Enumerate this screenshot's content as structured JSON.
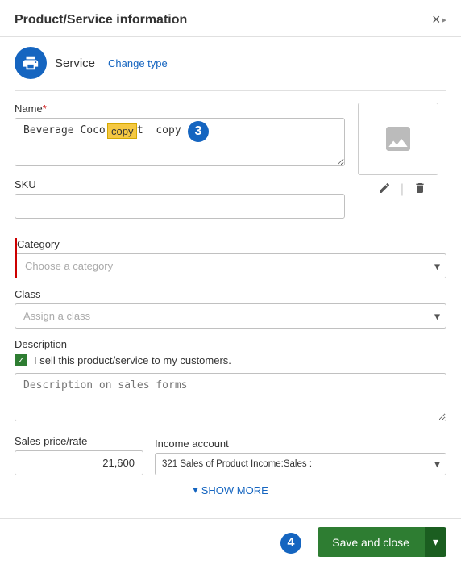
{
  "modal": {
    "title": "Product/Service information",
    "close_label": "×"
  },
  "service": {
    "type": "Service",
    "change_type": "Change type",
    "icon": "🖨"
  },
  "form": {
    "name_label": "Name",
    "name_required": "*",
    "name_value": "Beverage Coco Coast ",
    "name_copy": "copy",
    "sku_label": "SKU",
    "sku_value": "",
    "category_label": "Category",
    "category_placeholder": "Choose a category",
    "class_label": "Class",
    "class_placeholder": "Assign a class",
    "description_label": "Description",
    "description_checkbox_label": "I sell this product/service to my customers.",
    "description_placeholder": "Description on sales forms",
    "sales_price_label": "Sales price/rate",
    "sales_price_value": "21,600",
    "income_account_label": "Income account",
    "income_account_value": "321 Sales of Product Income:Sales :",
    "show_more": "SHOW MORE"
  },
  "footer": {
    "save_label": "Save and close",
    "dropdown_icon": "▾"
  },
  "steps": {
    "step3": "3",
    "step4": "4"
  }
}
